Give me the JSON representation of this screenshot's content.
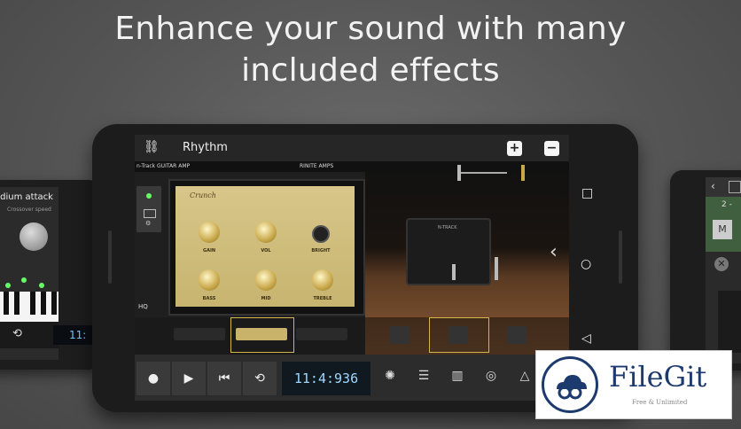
{
  "headline": {
    "line1": "Enhance your sound with many",
    "line2": "included effects"
  },
  "left_device": {
    "preset_label": "edium attack",
    "sub_label": "Crossover speed",
    "time_display": "11:"
  },
  "right_device": {
    "track_label": "2 -",
    "mute_label": "M"
  },
  "app": {
    "topbar": {
      "link_icon": "link-icon",
      "title": "Rhythm",
      "add_label": "+",
      "remove_label": "−"
    },
    "guitar_amp": {
      "header_left": "n-Track  GUITAR AMP",
      "header_right": "RINITE AMPS",
      "brand": "Crunch",
      "knobs": [
        "GAIN",
        "VOL",
        "BRIGHT",
        "BASS",
        "MID",
        "TREBLE"
      ],
      "hq_label": "HQ"
    },
    "cabinet": {
      "brand": "N-TRACK"
    },
    "transport": {
      "time": "11:4:936",
      "icons": [
        "record-icon",
        "play-icon",
        "rewind-icon",
        "loop-icon"
      ],
      "tools": [
        "effects-icon",
        "mixer-icon",
        "piano-icon",
        "drum-icon",
        "metronome-icon"
      ]
    },
    "android_nav": [
      "recents-icon",
      "home-icon",
      "back-icon"
    ]
  },
  "watermark": {
    "name": "FileGit",
    "tagline": "Free & Unlimited"
  },
  "colors": {
    "background": "#555555",
    "amp_gold": "#c7b46f",
    "time_text": "#9fd8ff",
    "brand_blue": "#1d3a6e"
  }
}
